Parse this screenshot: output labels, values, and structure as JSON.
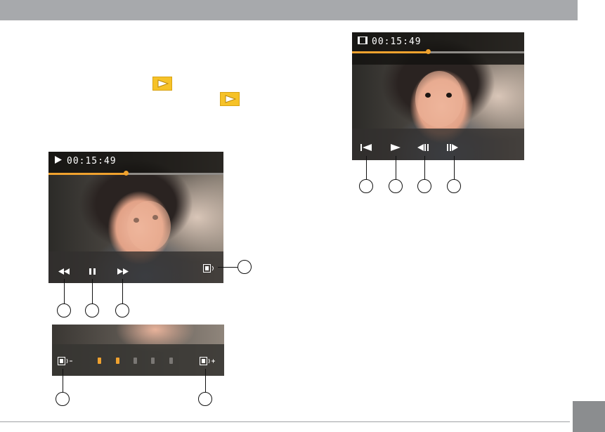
{
  "page": {
    "accent_color": "#f0a22e",
    "header_bar_color": "#a7a9ac",
    "inline_icons": [
      "play-icon",
      "play-icon"
    ]
  },
  "screens": {
    "video_play": {
      "status_icon": "play-icon",
      "time": "00:15:49",
      "progress": 0.44,
      "controls": [
        "rewind-icon",
        "pause-icon",
        "fast-forward-icon",
        "volume-icon"
      ]
    },
    "video_pause": {
      "status_icon": "video-icon",
      "time": "00:15:49",
      "progress": 0.44,
      "controls": [
        "previous-frame-icon",
        "play-icon",
        "step-back-icon",
        "step-forward-icon"
      ]
    },
    "volume": {
      "controls": [
        "volume-down-icon",
        "volume-up-icon"
      ],
      "level": 2,
      "max_level": 5
    }
  }
}
